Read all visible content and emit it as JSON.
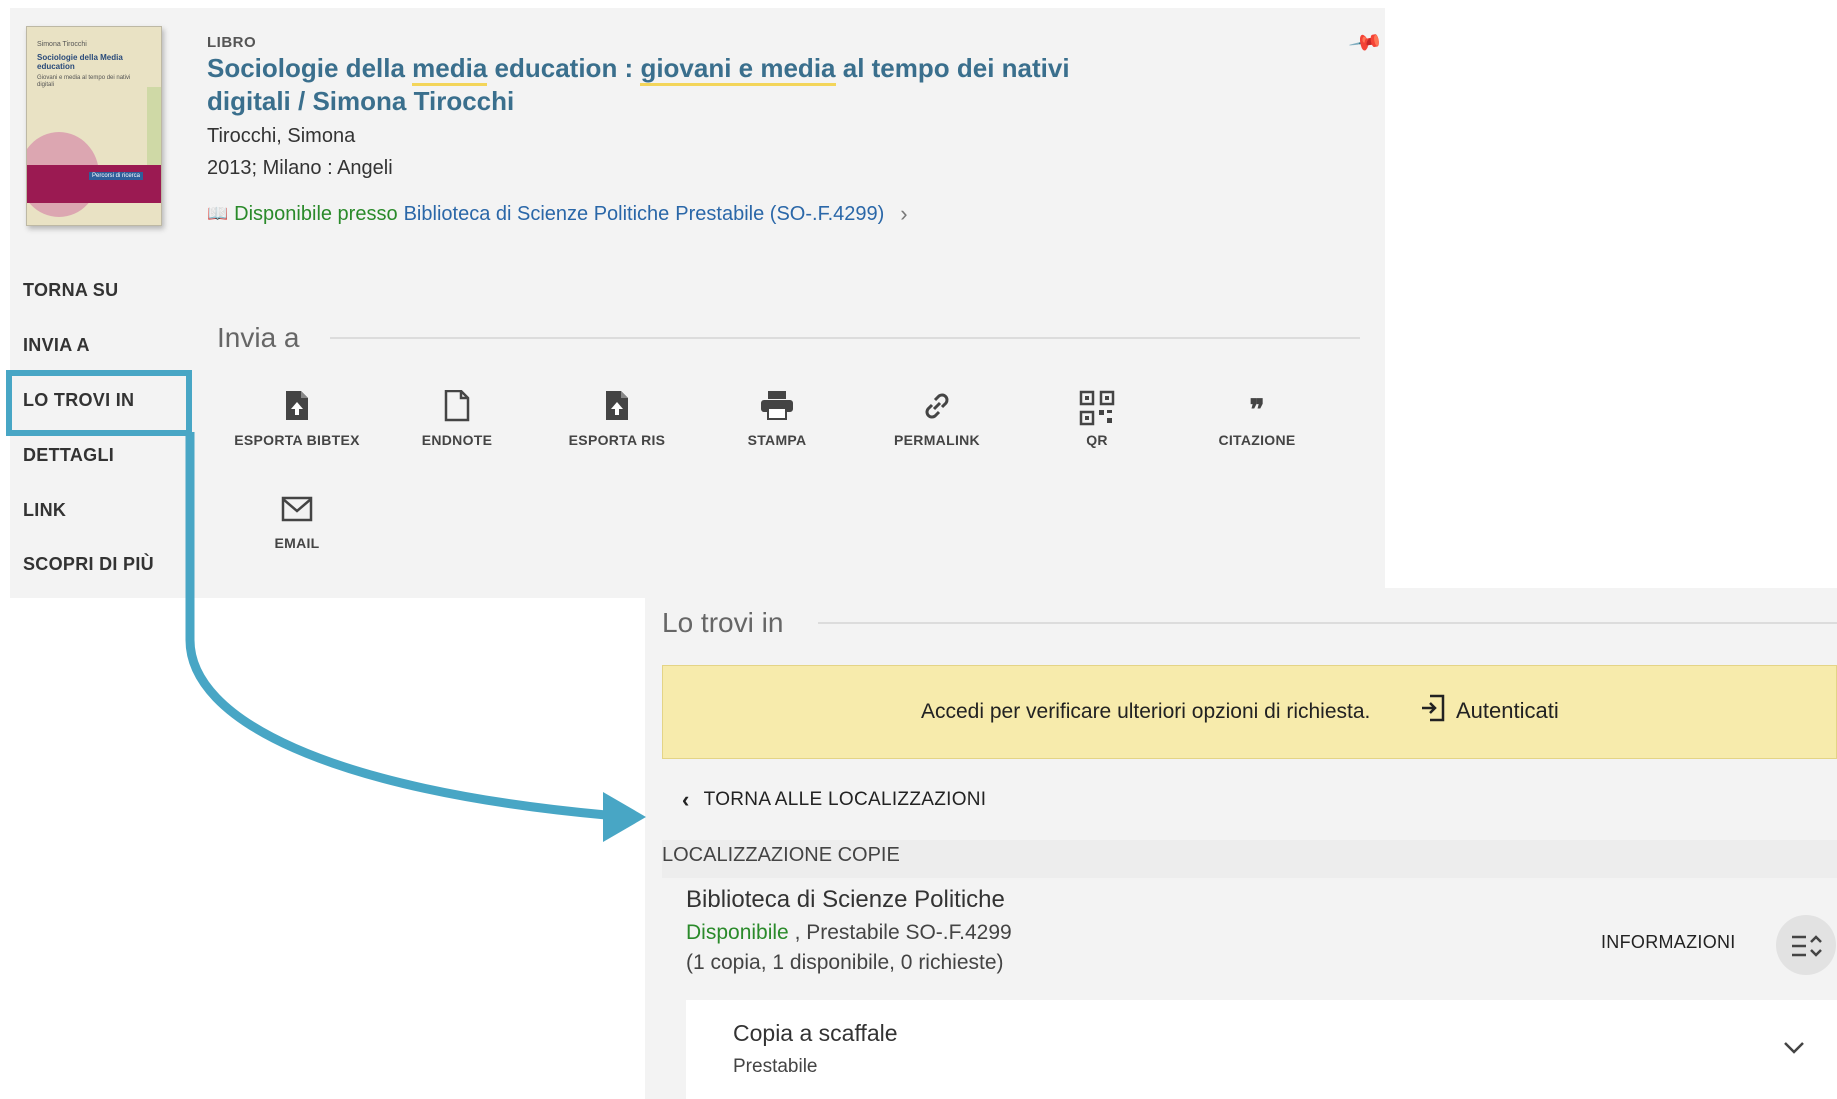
{
  "record": {
    "type": "LIBRO",
    "title_parts": {
      "p1": "Sociologie della ",
      "hl1": "media",
      "p2": " education : ",
      "hl2": "giovani e media",
      "p3": " al tempo dei nativi digitali / Simona Tirocchi"
    },
    "author": "Tirocchi, Simona",
    "publication": "2013; Milano : Angeli",
    "availability": {
      "status": "Disponibile presso",
      "library": "Biblioteca di Scienze Politiche",
      "location": "Prestabile (SO-.F.4299)"
    },
    "cover": {
      "author": "Simona Tirocchi",
      "title": "Sociologie della Media education",
      "subtitle": "Giovani e media al tempo dei nativi digitali",
      "series": "Percorsi di ricerca"
    }
  },
  "nav": {
    "items": [
      "TORNA SU",
      "INVIA A",
      "LO TROVI IN",
      "DETTAGLI",
      "LINK",
      "SCOPRI DI PIÙ"
    ],
    "active": "LO TROVI IN"
  },
  "send_to": {
    "title": "Invia a",
    "tools": [
      {
        "label": "ESPORTA BIBTEX",
        "icon": "export-file-icon"
      },
      {
        "label": "ENDNOTE",
        "icon": "file-icon"
      },
      {
        "label": "ESPORTA RIS",
        "icon": "export-file-icon"
      },
      {
        "label": "STAMPA",
        "icon": "printer-icon"
      },
      {
        "label": "PERMALINK",
        "icon": "link-icon"
      },
      {
        "label": "QR",
        "icon": "qr-code-icon"
      },
      {
        "label": "CITAZIONE",
        "icon": "quote-icon"
      },
      {
        "label": "EMAIL",
        "icon": "envelope-icon"
      }
    ]
  },
  "location": {
    "title": "Lo trovi in",
    "signin_message": "Accedi per verificare ulteriori opzioni di richiesta.",
    "signin_button": "Autenticati",
    "back_label": "TORNA ALLE LOCALIZZAZIONI",
    "copies_header": "LOCALIZZAZIONE COPIE",
    "library_name": "Biblioteca di Scienze Politiche",
    "status_available": "Disponibile",
    "status_rest": " , Prestabile SO-.F.4299",
    "counts": "(1 copia, 1 disponibile, 0 richieste)",
    "info_label": "INFORMAZIONI",
    "copy_title": "Copia a scaffale",
    "copy_status": "Prestabile"
  },
  "colors": {
    "highlight_box": "#48a6c5",
    "title_link": "#3a6f8d",
    "available_green": "#2a8a2a",
    "signin_bar": "#f7ebac"
  }
}
